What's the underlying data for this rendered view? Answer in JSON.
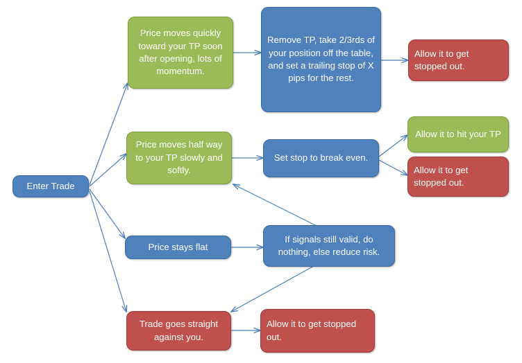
{
  "diagram": {
    "title": "Trade management flowchart",
    "colors": {
      "blue": "#4F81BD",
      "green": "#9BBB59",
      "red": "#C0504D",
      "connector": "#4A7EBB",
      "text": "#FFFFFF",
      "background": "#FFFFFF"
    },
    "nodes": {
      "enter_trade": "Enter Trade",
      "branch_quick": "Price moves quickly toward your TP soon after opening, lots of momentum.",
      "action_remove_tp": "Remove TP, take 2/3rds of your position off the table, and set a trailing stop of X pips for the rest.",
      "outcome_stopped_out_top": "Allow it to get stopped out.",
      "branch_half_way": "Price moves half way to your TP slowly and softly.",
      "action_break_even": "Set stop to break even.",
      "outcome_hit_tp": "Allow it to hit your TP",
      "outcome_stopped_out_mid": "Allow it to get stopped out.",
      "branch_flat": "Price stays flat",
      "action_signals": "If signals still valid, do nothing, else reduce risk.",
      "branch_against": "Trade goes straight against you.",
      "outcome_stopped_out_bottom": "Allow it to get stopped out."
    }
  }
}
